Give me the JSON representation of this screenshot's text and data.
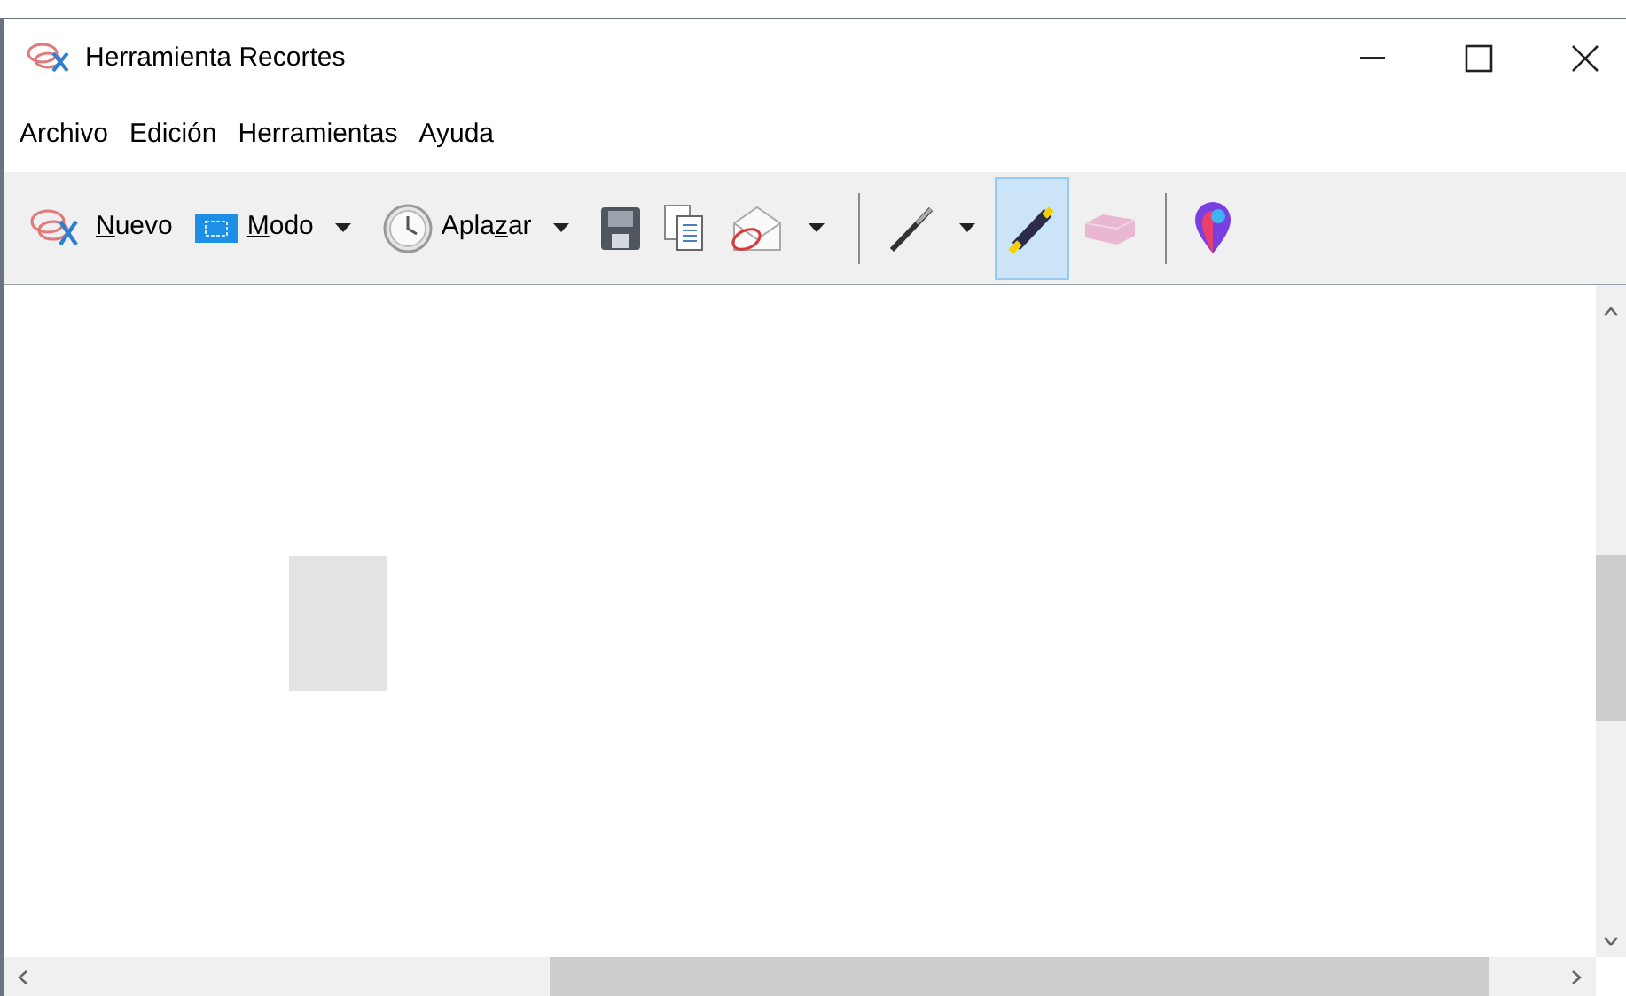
{
  "window": {
    "title": "Herramienta Recortes"
  },
  "menu": [
    {
      "label": "Archivo"
    },
    {
      "label": "Edición"
    },
    {
      "label": "Herramientas"
    },
    {
      "label": "Ayuda"
    }
  ],
  "toolbar": [
    {
      "kind": "scissors",
      "key": "N",
      "after": "uevo",
      "dropdown": false,
      "selected": false
    },
    {
      "kind": "mode",
      "key": "M",
      "after": "odo",
      "dropdown": true,
      "selected": false
    },
    {
      "kind": "clock",
      "before": "Apla",
      "key": "z",
      "after": "ar",
      "dropdown": true,
      "selected": false
    },
    {
      "kind": "save",
      "dropdown": false,
      "selected": false
    },
    {
      "kind": "copy",
      "dropdown": false,
      "selected": false
    },
    {
      "kind": "send",
      "dropdown": true,
      "selected": false
    },
    {
      "kind": "separator"
    },
    {
      "kind": "pen",
      "dropdown": true,
      "selected": false
    },
    {
      "kind": "highlighter",
      "dropdown": false,
      "selected": true
    },
    {
      "kind": "eraser",
      "dropdown": false,
      "selected": false
    },
    {
      "kind": "separator"
    },
    {
      "kind": "paint",
      "dropdown": false,
      "selected": false
    }
  ]
}
